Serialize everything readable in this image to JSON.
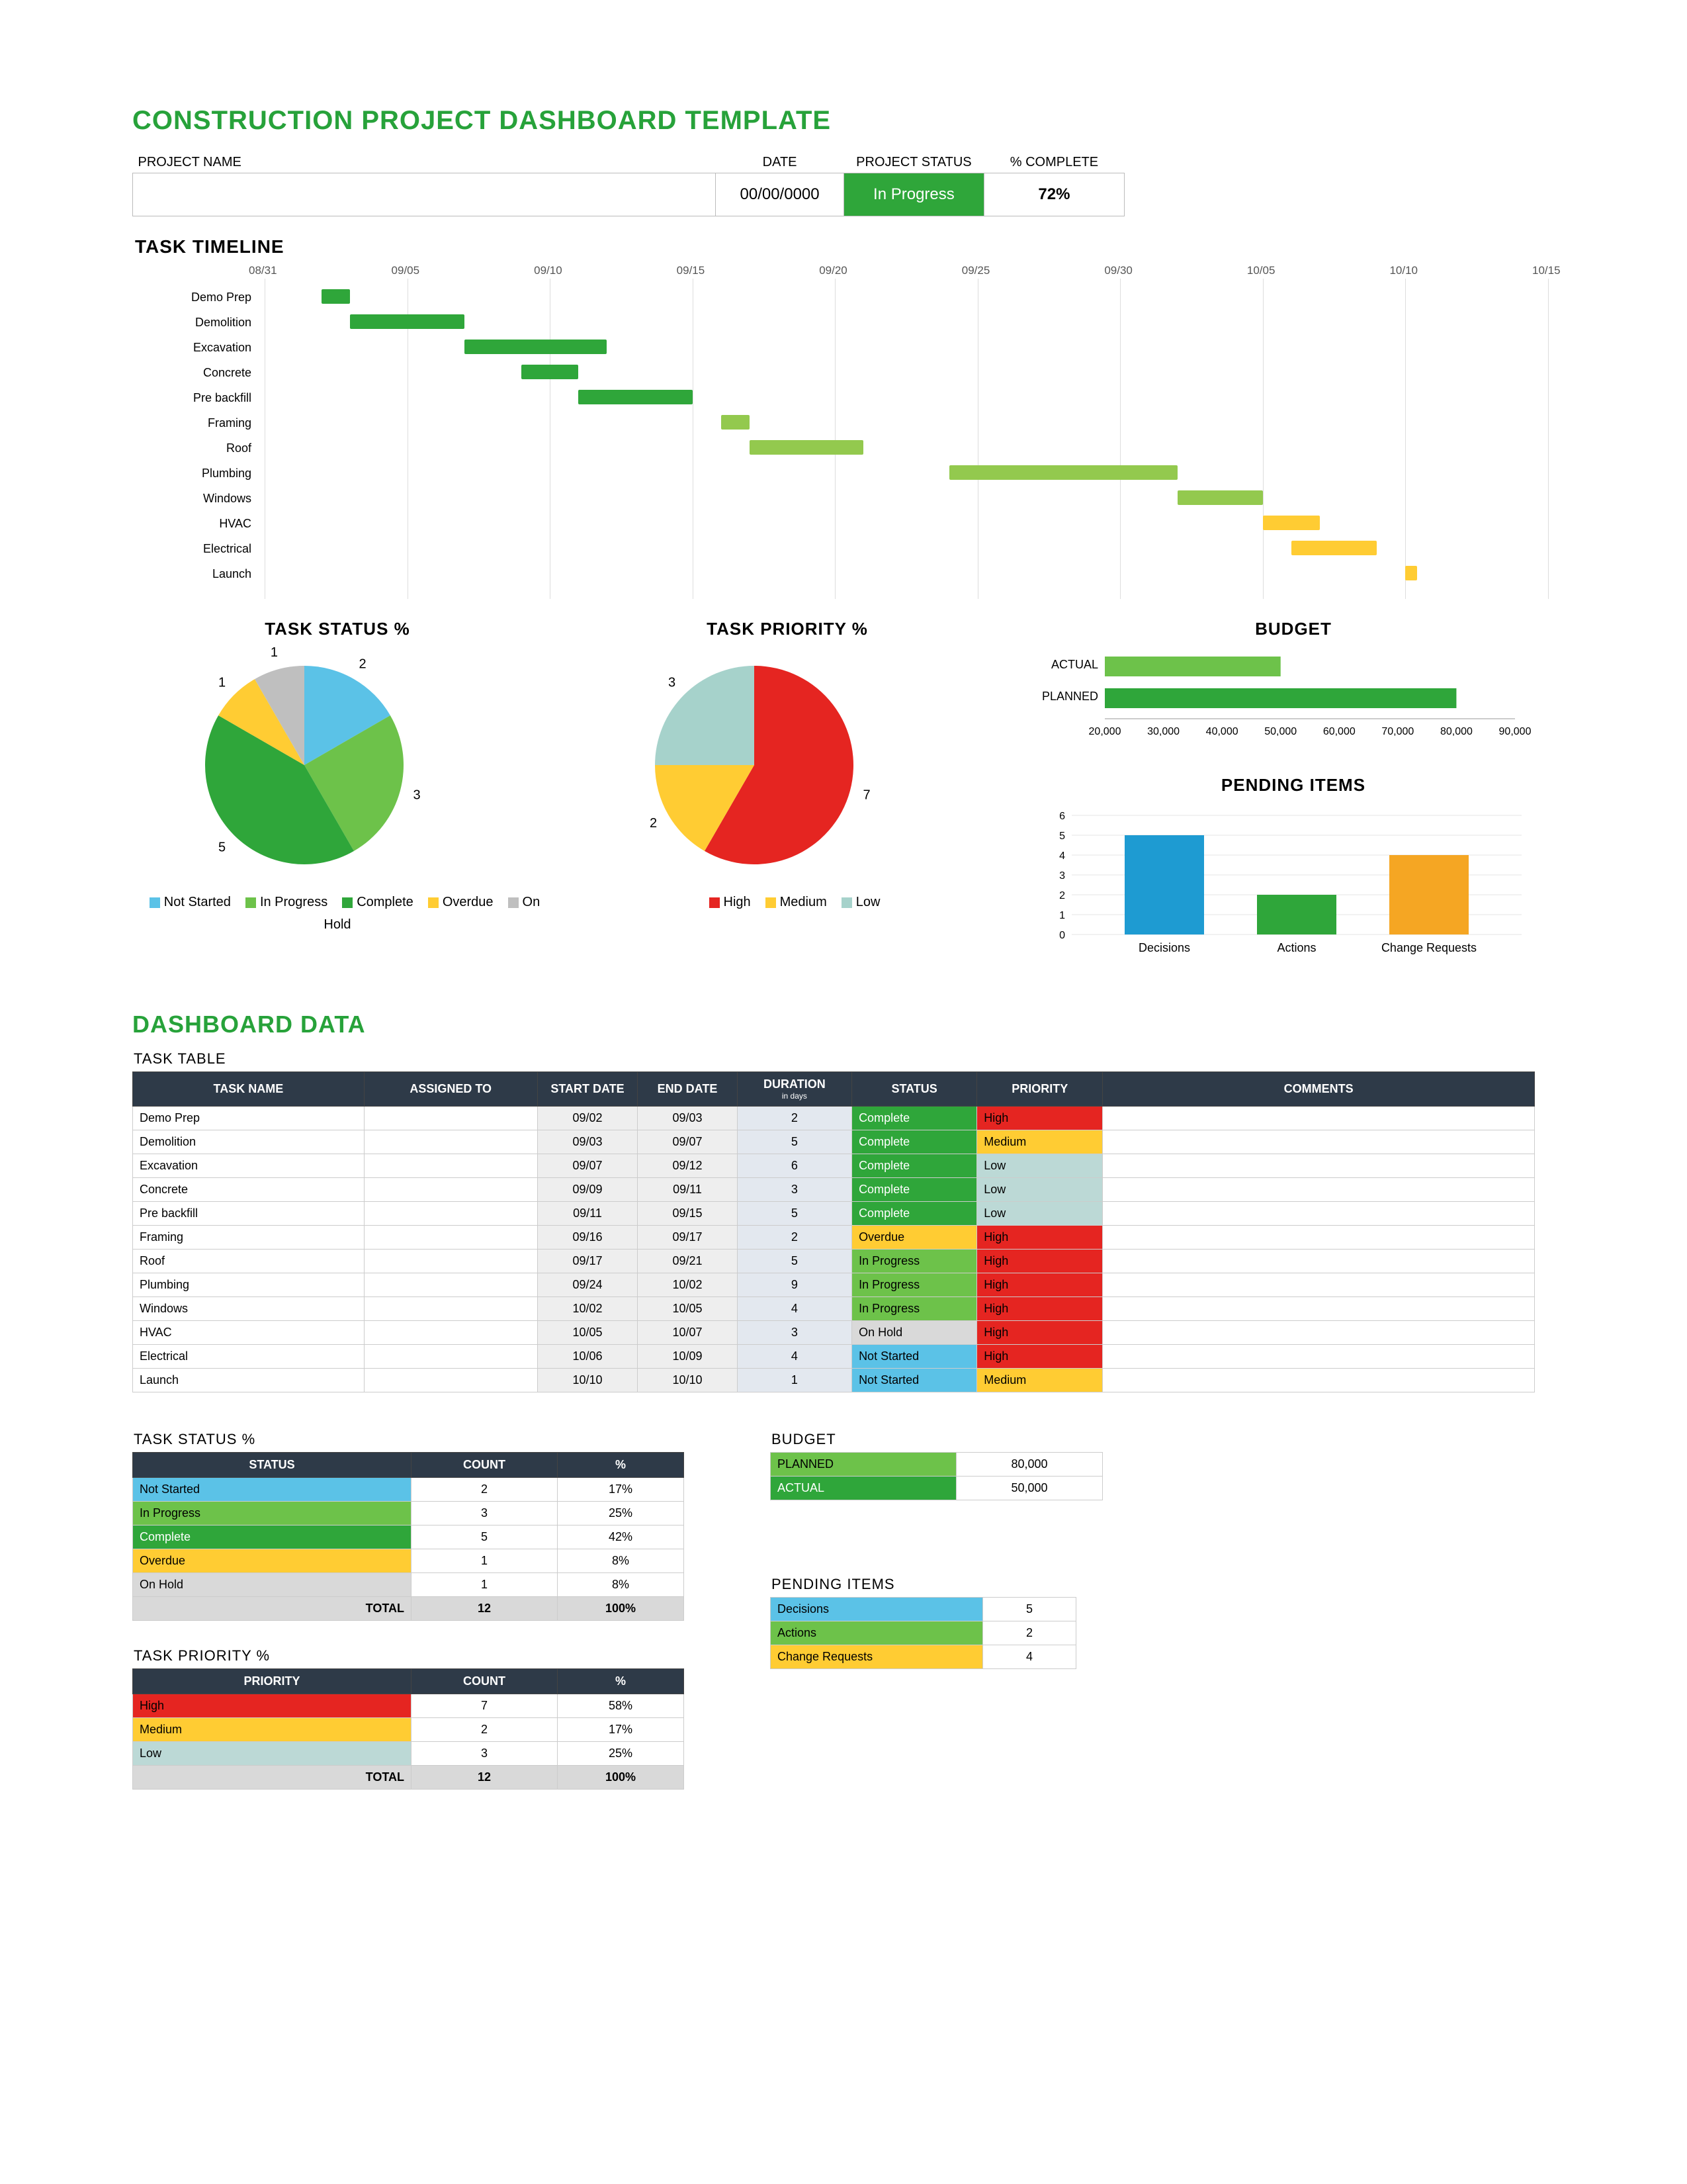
{
  "title": "CONSTRUCTION PROJECT DASHBOARD TEMPLATE",
  "header": {
    "labels": {
      "project_name": "PROJECT NAME",
      "date": "DATE",
      "status": "PROJECT STATUS",
      "pct": "% COMPLETE"
    },
    "project_name": "",
    "date": "00/00/0000",
    "status": "In Progress",
    "pct": "72%"
  },
  "sections": {
    "task_timeline": "TASK TIMELINE",
    "task_status": "TASK STATUS %",
    "task_priority": "TASK PRIORITY %",
    "budget": "BUDGET",
    "pending": "PENDING ITEMS",
    "dashboard_data": "DASHBOARD DATA",
    "task_table": "TASK TABLE"
  },
  "colors": {
    "green": "#2fa63a",
    "lgreen": "#6dc24a",
    "ygreen": "#93c94e",
    "yellow": "#ffcc33",
    "orange": "#f5a623",
    "teal": "#a6d2cb",
    "blue": "#5bc2e7",
    "red": "#e52521",
    "gray": "#bfbfbf"
  },
  "chart_data": [
    {
      "name": "task_timeline",
      "type": "gantt",
      "x_ticks": [
        "08/31",
        "09/05",
        "09/10",
        "09/15",
        "09/20",
        "09/25",
        "09/30",
        "10/05",
        "10/10",
        "10/15"
      ],
      "xlim": [
        "08/31",
        "10/15"
      ],
      "tasks": [
        {
          "label": "Demo Prep",
          "start": "09/02",
          "end": "09/03",
          "color": "#2fa63a"
        },
        {
          "label": "Demolition",
          "start": "09/03",
          "end": "09/07",
          "color": "#2fa63a"
        },
        {
          "label": "Excavation",
          "start": "09/07",
          "end": "09/12",
          "color": "#2fa63a"
        },
        {
          "label": "Concrete",
          "start": "09/09",
          "end": "09/11",
          "color": "#2fa63a"
        },
        {
          "label": "Pre backfill",
          "start": "09/11",
          "end": "09/15",
          "color": "#2fa63a"
        },
        {
          "label": "Framing",
          "start": "09/16",
          "end": "09/17",
          "color": "#93c94e"
        },
        {
          "label": "Roof",
          "start": "09/17",
          "end": "09/21",
          "color": "#93c94e"
        },
        {
          "label": "Plumbing",
          "start": "09/24",
          "end": "10/02",
          "color": "#93c94e"
        },
        {
          "label": "Windows",
          "start": "10/02",
          "end": "10/05",
          "color": "#93c94e"
        },
        {
          "label": "HVAC",
          "start": "10/05",
          "end": "10/07",
          "color": "#ffcc33"
        },
        {
          "label": "Electrical",
          "start": "10/06",
          "end": "10/09",
          "color": "#ffcc33"
        },
        {
          "label": "Launch",
          "start": "10/10",
          "end": "10/10",
          "color": "#ffcc33"
        }
      ]
    },
    {
      "name": "task_status_pie",
      "type": "pie",
      "title": "TASK STATUS %",
      "series": [
        {
          "name": "Not Started",
          "value": 2,
          "color": "#5bc2e7"
        },
        {
          "name": "In Progress",
          "value": 3,
          "color": "#6dc24a"
        },
        {
          "name": "Complete",
          "value": 5,
          "color": "#2fa63a"
        },
        {
          "name": "Overdue",
          "value": 1,
          "color": "#ffcc33"
        },
        {
          "name": "On Hold",
          "value": 1,
          "color": "#bfbfbf"
        }
      ]
    },
    {
      "name": "task_priority_pie",
      "type": "pie",
      "title": "TASK PRIORITY %",
      "series": [
        {
          "name": "High",
          "value": 7,
          "color": "#e52521"
        },
        {
          "name": "Medium",
          "value": 2,
          "color": "#ffcc33"
        },
        {
          "name": "Low",
          "value": 3,
          "color": "#a6d2cb"
        }
      ]
    },
    {
      "name": "budget_bar",
      "type": "bar",
      "orientation": "horizontal",
      "title": "BUDGET",
      "categories": [
        "ACTUAL",
        "PLANNED"
      ],
      "values": [
        50000,
        80000
      ],
      "xlim": [
        20000,
        90000
      ],
      "x_ticks": [
        20000,
        30000,
        40000,
        50000,
        60000,
        70000,
        80000,
        90000
      ],
      "colors": [
        "#6dc24a",
        "#2fa63a"
      ]
    },
    {
      "name": "pending_bar",
      "type": "bar",
      "title": "PENDING ITEMS",
      "categories": [
        "Decisions",
        "Actions",
        "Change Requests"
      ],
      "values": [
        5,
        2,
        4
      ],
      "ylim": [
        0,
        6
      ],
      "y_ticks": [
        0,
        1,
        2,
        3,
        4,
        5,
        6
      ],
      "colors": [
        "#1e9bd2",
        "#2fa63a",
        "#f5a623"
      ]
    }
  ],
  "task_table": {
    "columns": [
      "TASK NAME",
      "ASSIGNED TO",
      "START DATE",
      "END DATE",
      "DURATION",
      "STATUS",
      "PRIORITY",
      "COMMENTS"
    ],
    "duration_sub": "in days",
    "rows": [
      {
        "name": "Demo Prep",
        "assigned": "",
        "start": "09/02",
        "end": "09/03",
        "dur": "2",
        "status": "Complete",
        "s": "green",
        "priority": "High",
        "p": "red"
      },
      {
        "name": "Demolition",
        "assigned": "",
        "start": "09/03",
        "end": "09/07",
        "dur": "5",
        "status": "Complete",
        "s": "green",
        "priority": "Medium",
        "p": "yellow"
      },
      {
        "name": "Excavation",
        "assigned": "",
        "start": "09/07",
        "end": "09/12",
        "dur": "6",
        "status": "Complete",
        "s": "green",
        "priority": "Low",
        "p": "teal"
      },
      {
        "name": "Concrete",
        "assigned": "",
        "start": "09/09",
        "end": "09/11",
        "dur": "3",
        "status": "Complete",
        "s": "green",
        "priority": "Low",
        "p": "teal"
      },
      {
        "name": "Pre backfill",
        "assigned": "",
        "start": "09/11",
        "end": "09/15",
        "dur": "5",
        "status": "Complete",
        "s": "green",
        "priority": "Low",
        "p": "teal"
      },
      {
        "name": "Framing",
        "assigned": "",
        "start": "09/16",
        "end": "09/17",
        "dur": "2",
        "status": "Overdue",
        "s": "yellow",
        "priority": "High",
        "p": "red"
      },
      {
        "name": "Roof",
        "assigned": "",
        "start": "09/17",
        "end": "09/21",
        "dur": "5",
        "status": "In Progress",
        "s": "lgreen",
        "priority": "High",
        "p": "red"
      },
      {
        "name": "Plumbing",
        "assigned": "",
        "start": "09/24",
        "end": "10/02",
        "dur": "9",
        "status": "In Progress",
        "s": "lgreen",
        "priority": "High",
        "p": "red"
      },
      {
        "name": "Windows",
        "assigned": "",
        "start": "10/02",
        "end": "10/05",
        "dur": "4",
        "status": "In Progress",
        "s": "lgreen",
        "priority": "High",
        "p": "red"
      },
      {
        "name": "HVAC",
        "assigned": "",
        "start": "10/05",
        "end": "10/07",
        "dur": "3",
        "status": "On Hold",
        "s": "gray",
        "priority": "High",
        "p": "red"
      },
      {
        "name": "Electrical",
        "assigned": "",
        "start": "10/06",
        "end": "10/09",
        "dur": "4",
        "status": "Not Started",
        "s": "blue",
        "priority": "High",
        "p": "red"
      },
      {
        "name": "Launch",
        "assigned": "",
        "start": "10/10",
        "end": "10/10",
        "dur": "1",
        "status": "Not Started",
        "s": "blue",
        "priority": "Medium",
        "p": "yellow"
      }
    ]
  },
  "status_summary": {
    "title": "TASK STATUS %",
    "headers": [
      "STATUS",
      "COUNT",
      "%"
    ],
    "rows": [
      {
        "label": "Not Started",
        "c": "blue",
        "count": 2,
        "pct": "17%"
      },
      {
        "label": "In Progress",
        "c": "lgreen",
        "count": 3,
        "pct": "25%"
      },
      {
        "label": "Complete",
        "c": "green",
        "count": 5,
        "pct": "42%"
      },
      {
        "label": "Overdue",
        "c": "yellow",
        "count": 1,
        "pct": "8%"
      },
      {
        "label": "On Hold",
        "c": "gray",
        "count": 1,
        "pct": "8%"
      }
    ],
    "total_label": "TOTAL",
    "total_count": 12,
    "total_pct": "100%"
  },
  "priority_summary": {
    "title": "TASK PRIORITY %",
    "headers": [
      "PRIORITY",
      "COUNT",
      "%"
    ],
    "rows": [
      {
        "label": "High",
        "c": "red",
        "count": 7,
        "pct": "58%"
      },
      {
        "label": "Medium",
        "c": "yellow",
        "count": 2,
        "pct": "17%"
      },
      {
        "label": "Low",
        "c": "teal",
        "count": 3,
        "pct": "25%"
      }
    ],
    "total_label": "TOTAL",
    "total_count": 12,
    "total_pct": "100%"
  },
  "budget_summary": {
    "title": "BUDGET",
    "rows": [
      {
        "label": "PLANNED",
        "c": "lgreen",
        "val": "80,000"
      },
      {
        "label": "ACTUAL",
        "c": "green",
        "val": "50,000"
      }
    ]
  },
  "pending_summary": {
    "title": "PENDING ITEMS",
    "rows": [
      {
        "label": "Decisions",
        "c": "blue",
        "val": 5
      },
      {
        "label": "Actions",
        "c": "lgreen",
        "val": 2
      },
      {
        "label": "Change Requests",
        "c": "yellow",
        "val": 4
      }
    ]
  }
}
